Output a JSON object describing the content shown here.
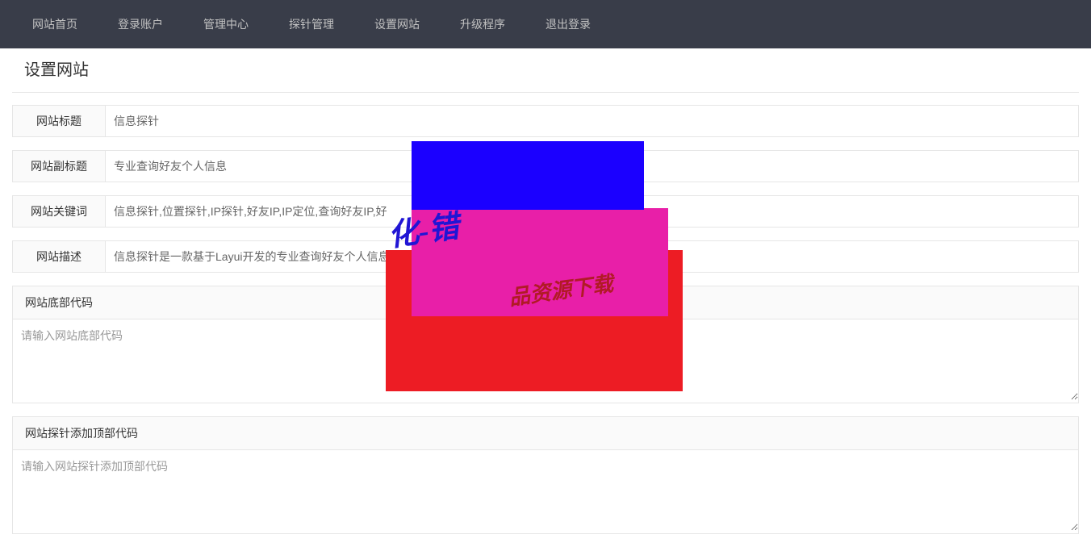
{
  "nav": {
    "items": [
      {
        "label": "网站首页"
      },
      {
        "label": "登录账户"
      },
      {
        "label": "管理中心"
      },
      {
        "label": "探针管理"
      },
      {
        "label": "设置网站"
      },
      {
        "label": "升级程序"
      },
      {
        "label": "退出登录"
      }
    ]
  },
  "legend": "设置网站",
  "fields": {
    "title": {
      "label": "网站标题",
      "value": "信息探针"
    },
    "subtitle": {
      "label": "网站副标题",
      "value": "专业查询好友个人信息"
    },
    "keywords": {
      "label": "网站关键词",
      "value": "信息探针,位置探针,IP探针,好友IP,IP定位,查询好友IP,好"
    },
    "description": {
      "label": "网站描述",
      "value": "信息探针是一款基于Layui开发的专业查询好友个人信息"
    }
  },
  "sections": {
    "footer_code": {
      "header": "网站底部代码",
      "placeholder": "请输入网站底部代码",
      "value": ""
    },
    "probe_top_code": {
      "header": "网站探针添加顶部代码",
      "placeholder": "请输入网站探针添加顶部代码",
      "value": ""
    }
  },
  "overlay": {
    "scribble1": "化-错",
    "scribble2": "品资源下载"
  }
}
